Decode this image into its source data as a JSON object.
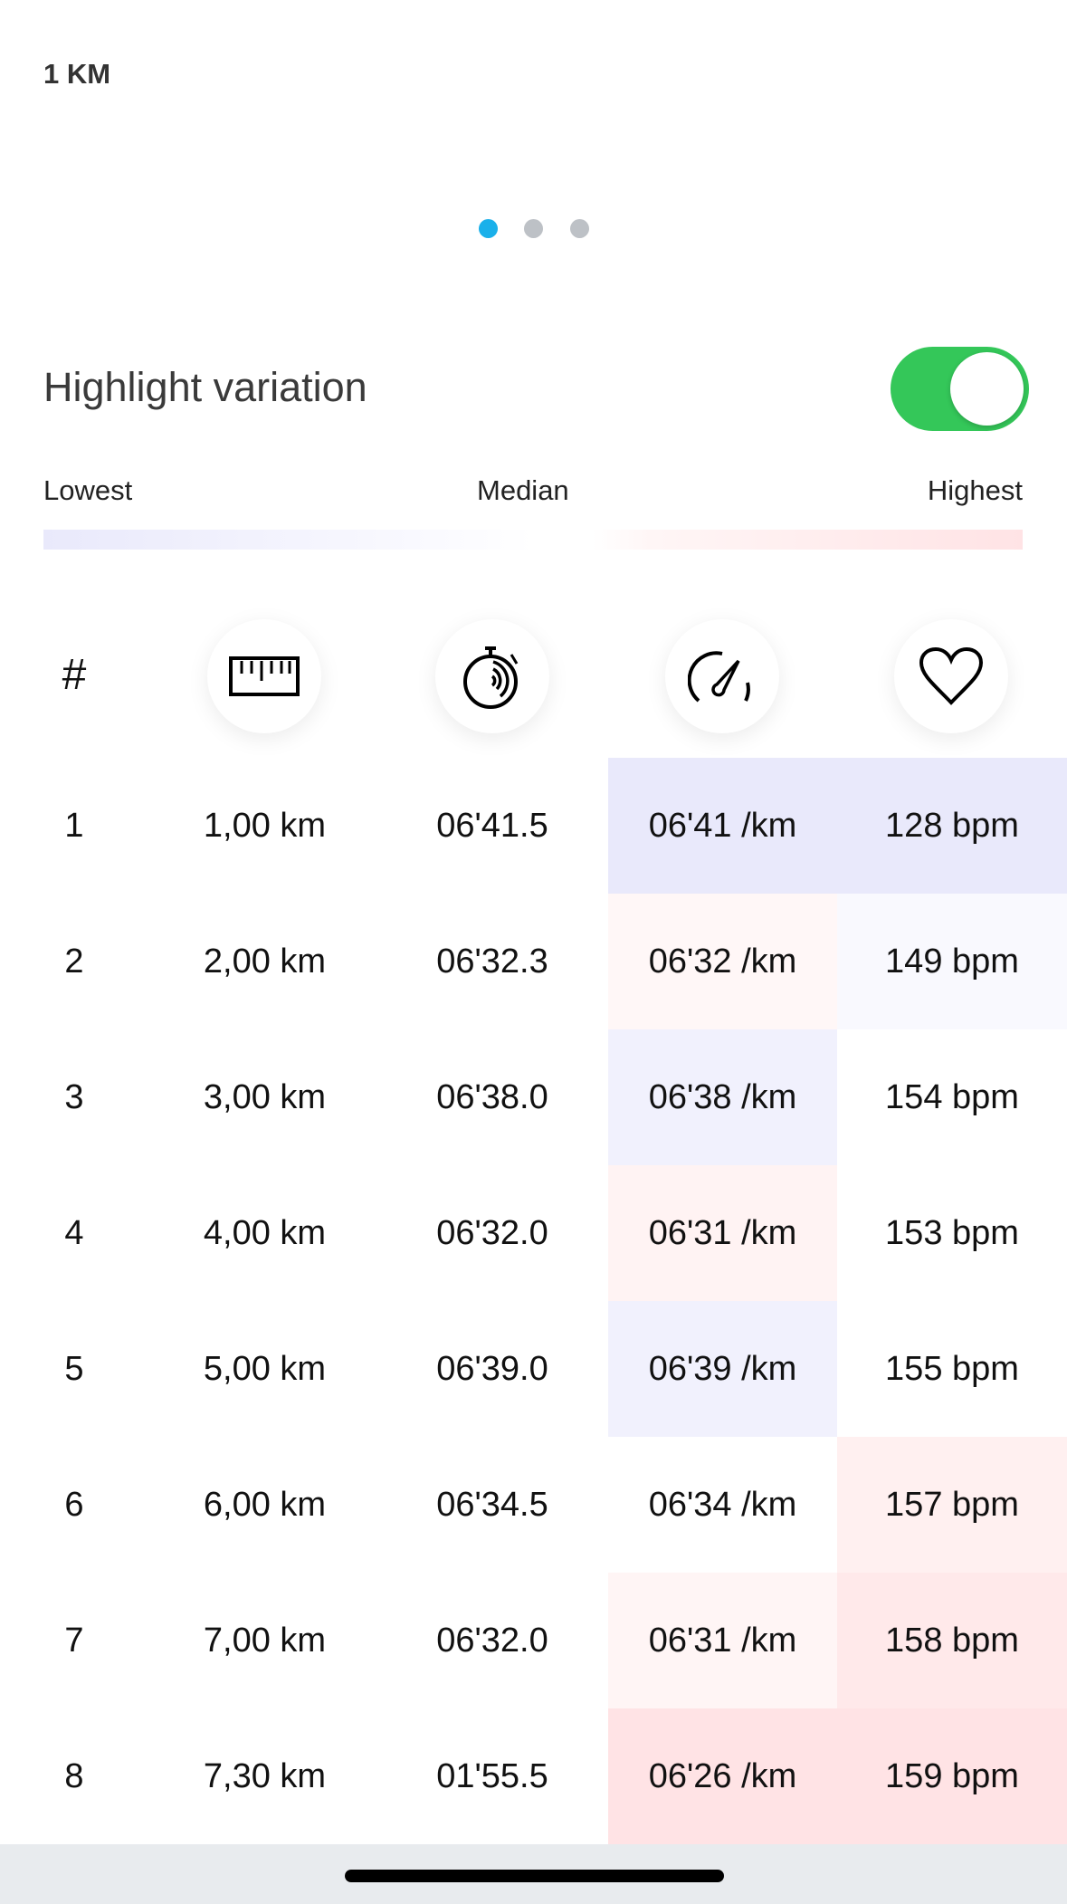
{
  "title": "1 KM",
  "pager": {
    "count": 3,
    "active": 0,
    "active_color": "#1ab0ea",
    "inactive_color": "#bdc1c6"
  },
  "highlight": {
    "label": "Highlight variation",
    "enabled": true,
    "toggle_color": "#34c759"
  },
  "scale": {
    "lowest": "Lowest",
    "median": "Median",
    "highest": "Highest",
    "low_color": "#e9e9fb",
    "high_color": "#ffe3e5"
  },
  "table": {
    "headers": [
      {
        "label": "#"
      },
      {
        "icon": "ruler-icon"
      },
      {
        "icon": "stopwatch-icon"
      },
      {
        "icon": "speedometer-icon"
      },
      {
        "icon": "heart-icon"
      }
    ],
    "rows": [
      {
        "n": "1",
        "dist": "1,00 km",
        "time": "06'41.5",
        "pace": "06'41 /km",
        "hr": "128 bpm",
        "pace_bg": "#e9e9fb",
        "hr_bg": "#e9e9fb"
      },
      {
        "n": "2",
        "dist": "2,00 km",
        "time": "06'32.3",
        "pace": "06'32 /km",
        "hr": "149 bpm",
        "pace_bg": "#fff7f7",
        "hr_bg": "#f9f9fe"
      },
      {
        "n": "3",
        "dist": "3,00 km",
        "time": "06'38.0",
        "pace": "06'38 /km",
        "hr": "154 bpm",
        "pace_bg": "#f1f1fd",
        "hr_bg": "#ffffff"
      },
      {
        "n": "4",
        "dist": "4,00 km",
        "time": "06'32.0",
        "pace": "06'31 /km",
        "hr": "153 bpm",
        "pace_bg": "#fff3f3",
        "hr_bg": "#ffffff"
      },
      {
        "n": "5",
        "dist": "5,00 km",
        "time": "06'39.0",
        "pace": "06'39 /km",
        "hr": "155 bpm",
        "pace_bg": "#f1f1fd",
        "hr_bg": "#ffffff"
      },
      {
        "n": "6",
        "dist": "6,00 km",
        "time": "06'34.5",
        "pace": "06'34 /km",
        "hr": "157 bpm",
        "pace_bg": "#ffffff",
        "hr_bg": "#fff0f0"
      },
      {
        "n": "7",
        "dist": "7,00 km",
        "time": "06'32.0",
        "pace": "06'31 /km",
        "hr": "158 bpm",
        "pace_bg": "#fff5f5",
        "hr_bg": "#ffe9ea"
      },
      {
        "n": "8",
        "dist": "7,30 km",
        "time": "01'55.5",
        "pace": "06'26 /km",
        "hr": "159 bpm",
        "pace_bg": "#ffe3e5",
        "hr_bg": "#ffe3e5"
      }
    ]
  }
}
